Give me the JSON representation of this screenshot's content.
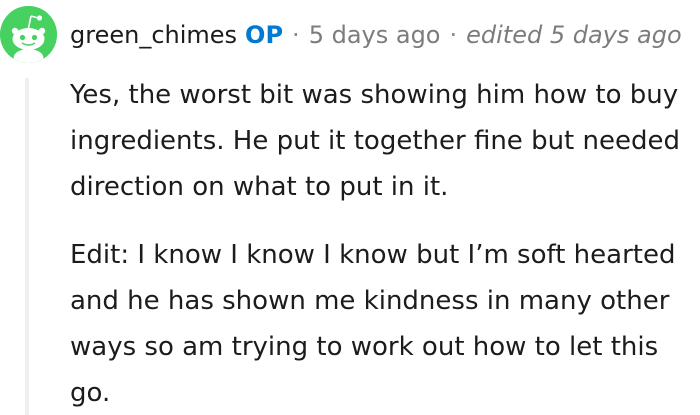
{
  "comment": {
    "username": "green_chimes",
    "op_badge": "OP",
    "separator": "·",
    "timestamp": "5 days ago",
    "edited": "edited 5 days ago",
    "avatar_icon": "snoo-avatar-icon",
    "avatar_color": "#46d160",
    "paragraphs": [
      "Yes, the worst bit was showing him how to buy ingredients. He put it together fine but needed direction on what to put in it.",
      "Edit: I know I know I know but I’m soft hearted and he has shown me kindness in many other ways so am trying to work out how to let this go."
    ]
  }
}
